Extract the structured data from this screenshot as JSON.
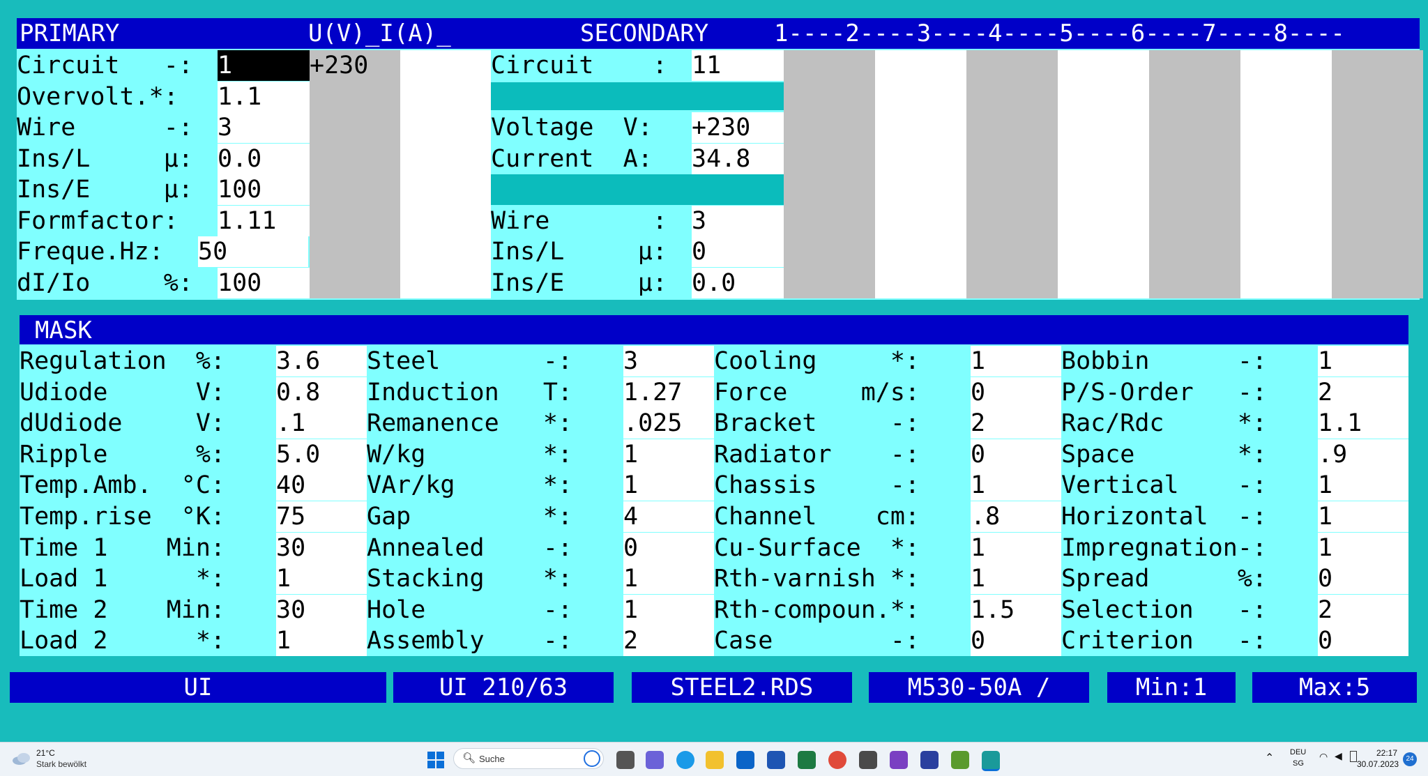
{
  "primary": {
    "header": "PRIMARY",
    "ui_header": "U(V)_I(A)_",
    "rows": [
      {
        "label": "Circuit   -:",
        "value": "1"
      },
      {
        "label": "Overvolt.*:",
        "value": "1.1"
      },
      {
        "label": "Wire      -:",
        "value": "3"
      },
      {
        "label": "Ins/L     μ:",
        "value": "0.0"
      },
      {
        "label": "Ins/E     μ:",
        "value": "100"
      },
      {
        "label": "Formfactor:",
        "value": "1.11"
      },
      {
        "label": "Freque.Hz:",
        "value": "50"
      },
      {
        "label": "dI/Io     %:",
        "value": "100"
      }
    ],
    "ui_value": "+230"
  },
  "secondary": {
    "header": "SECONDARY",
    "columns_header": "1----2----3----4----5----6----7----8----",
    "rows": [
      {
        "label": "Circuit    :",
        "value": "11"
      },
      {
        "label": "",
        "value": ""
      },
      {
        "label": "Voltage  V:",
        "value": "+230"
      },
      {
        "label": "Current  A:",
        "value": "34.8"
      },
      {
        "label": "",
        "value": ""
      },
      {
        "label": "Wire       :",
        "value": "3"
      },
      {
        "label": "Ins/L     μ:",
        "value": "0"
      },
      {
        "label": "Ins/E     μ:",
        "value": "0.0"
      }
    ]
  },
  "mask": {
    "header": "MASK",
    "columns": [
      [
        {
          "label": "Regulation  %:",
          "value": "3.6"
        },
        {
          "label": "Udiode      V:",
          "value": "0.8"
        },
        {
          "label": "dUdiode     V:",
          "value": ".1"
        },
        {
          "label": "Ripple      %:",
          "value": "5.0"
        },
        {
          "label": "Temp.Amb.  °C:",
          "value": "40"
        },
        {
          "label": "Temp.rise  °K:",
          "value": "75"
        },
        {
          "label": "Time 1    Min:",
          "value": "30"
        },
        {
          "label": "Load 1      *:",
          "value": "1"
        },
        {
          "label": "Time 2    Min:",
          "value": "30"
        },
        {
          "label": "Load 2      *:",
          "value": "1"
        }
      ],
      [
        {
          "label": "Steel       -:",
          "value": "3"
        },
        {
          "label": "Induction   T:",
          "value": "1.27"
        },
        {
          "label": "Remanence   *:",
          "value": ".025"
        },
        {
          "label": "W/kg        *:",
          "value": "1"
        },
        {
          "label": "VAr/kg      *:",
          "value": "1"
        },
        {
          "label": "Gap         *:",
          "value": "4"
        },
        {
          "label": "Annealed    -:",
          "value": "0"
        },
        {
          "label": "Stacking    *:",
          "value": "1"
        },
        {
          "label": "Hole        -:",
          "value": "1"
        },
        {
          "label": "Assembly    -:",
          "value": "2"
        }
      ],
      [
        {
          "label": "Cooling     *:",
          "value": "1"
        },
        {
          "label": "Force     m/s:",
          "value": "0"
        },
        {
          "label": "Bracket     -:",
          "value": "2"
        },
        {
          "label": "Radiator    -:",
          "value": "0"
        },
        {
          "label": "Chassis     -:",
          "value": "1"
        },
        {
          "label": "Channel    cm:",
          "value": ".8"
        },
        {
          "label": "Cu-Surface  *:",
          "value": "1"
        },
        {
          "label": "Rth-varnish *:",
          "value": "1"
        },
        {
          "label": "Rth-compoun.*:",
          "value": "1.5"
        },
        {
          "label": "Case        -:",
          "value": "0"
        }
      ],
      [
        {
          "label": "Bobbin      -:",
          "value": "1"
        },
        {
          "label": "P/S-Order   -:",
          "value": "2"
        },
        {
          "label": "Rac/Rdc     *:",
          "value": "1.1"
        },
        {
          "label": "Space       *:",
          "value": ".9"
        },
        {
          "label": "Vertical    -:",
          "value": "1"
        },
        {
          "label": "Horizontal  -:",
          "value": "1"
        },
        {
          "label": "Impregnation-:",
          "value": "1"
        },
        {
          "label": "Spread      %:",
          "value": "0"
        },
        {
          "label": "Selection   -:",
          "value": "2"
        },
        {
          "label": "Criterion   -:",
          "value": "0"
        }
      ]
    ]
  },
  "status": [
    "UI",
    "UI 210/63",
    "STEEL2.RDS",
    "M530-50A /",
    "Min:1",
    "Max:5"
  ],
  "taskbar": {
    "weather_temp": "21°C",
    "weather_text": "Stark bewölkt",
    "search_placeholder": "Suche",
    "lang_top": "DEU",
    "lang_bottom": "SG",
    "time": "22:17",
    "date": "30.07.2023",
    "notification_count": "24"
  },
  "colors": {
    "header_blue": "#0000c8",
    "label_cyan": "#80ffff",
    "background_teal": "#18bcbc",
    "grid_gray": "#c0c0c0"
  }
}
